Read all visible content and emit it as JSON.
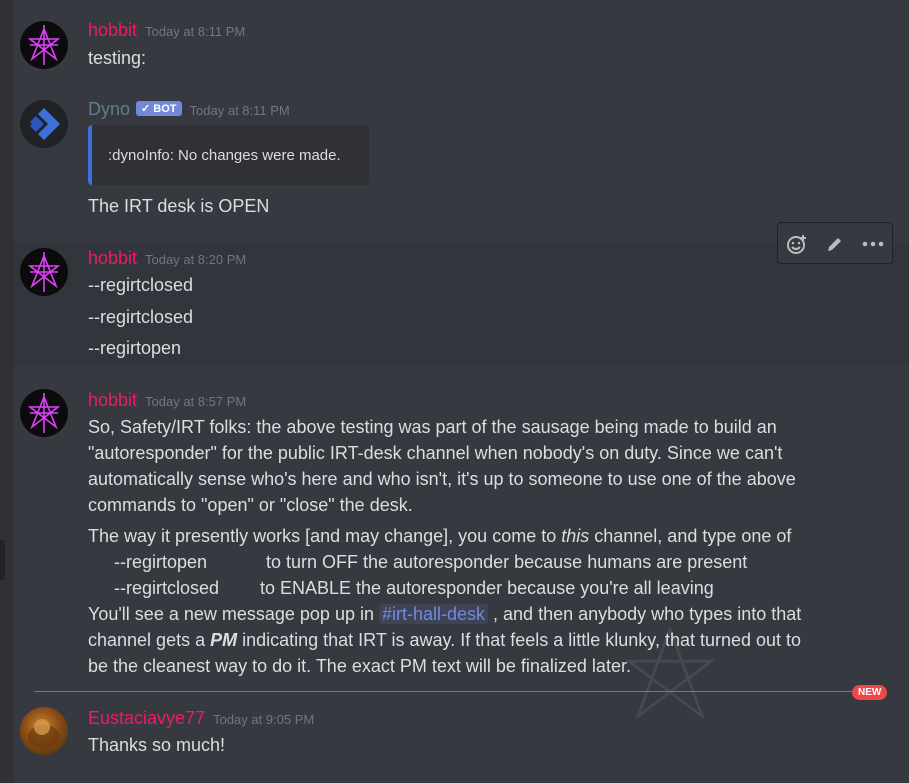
{
  "colors": {
    "background": "#36393f",
    "username_pink": "#e91e63",
    "dyno_name": "#607d8b",
    "mention": "#7289da",
    "new_red": "#f04747"
  },
  "messages": [
    {
      "author": "hobbit",
      "time": "Today at 8:11 PM",
      "lines": [
        "testing:"
      ]
    },
    {
      "author": "Dyno",
      "badge": "✓ BOT",
      "time": "Today at 8:11 PM",
      "embed": ":dynoInfo: No changes were made.",
      "lines": [
        "The IRT desk is OPEN"
      ]
    },
    {
      "author": "hobbit",
      "time": "Today at 8:20 PM",
      "lines": [
        "--regirtclosed",
        "--regirtclosed",
        "--regirtopen"
      ]
    },
    {
      "author": "hobbit",
      "time": "Today at 8:57 PM",
      "p1": [
        "So, Safety/IRT folks: the above testing was part of the sausage being made to build an",
        "\"autoresponder\" for the public IRT-desk channel when nobody's on duty.  Since we can't",
        "automatically sense who's here and who isn't, it's up to someone to use one of the above",
        "commands to \"open\" or \"close\" the desk."
      ],
      "p2_pre": "The way it presently works [and may change], you come to ",
      "p2_em": "this",
      "p2_post": " channel, and type one of",
      "cmd1": "--regirtopen",
      "cmd1_desc": "to turn OFF the autoresponder because humans are present",
      "cmd2": "--regirtclosed",
      "cmd2_desc": "to ENABLE the autoresponder because you're all leaving",
      "l_pre": "You'll see a new message pop up in ",
      "l_mention": "#irt-hall-desk",
      "l_post": " , and then anybody who types into that",
      "m_pre": "channel gets a ",
      "m_em": "PM",
      "m_post": " indicating that IRT is away.  If that feels a little klunky, that turned out to",
      "last": "be the cleanest way to do it.  The exact PM text will be finalized later."
    },
    {
      "author": "Eustaciavye77",
      "time": "Today at 9:05 PM",
      "lines": [
        "Thanks so much!"
      ]
    }
  ],
  "new_badge": "NEW",
  "toolbar": {
    "icons": [
      "add-reaction-icon",
      "edit-icon",
      "more-icon"
    ]
  }
}
